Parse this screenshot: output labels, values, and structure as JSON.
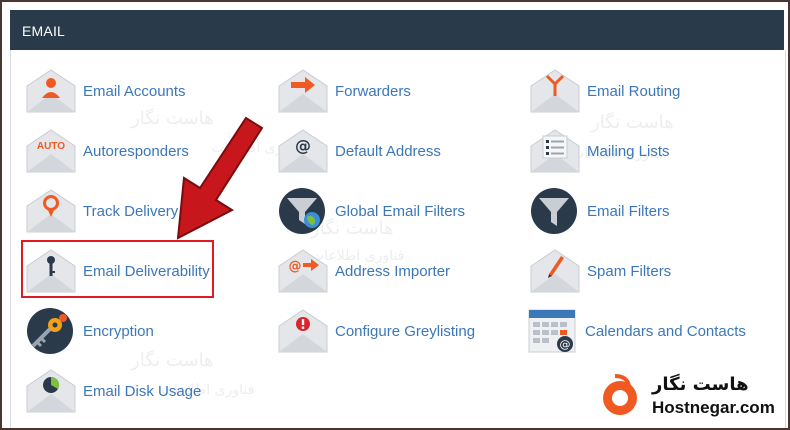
{
  "header": {
    "title": "EMAIL"
  },
  "items": [
    {
      "label": "Email Accounts",
      "icon": "envelope-person-icon"
    },
    {
      "label": "Forwarders",
      "icon": "envelope-arrow-icon"
    },
    {
      "label": "Email Routing",
      "icon": "envelope-routing-icon"
    },
    {
      "label": "Autoresponders",
      "icon": "envelope-auto-icon"
    },
    {
      "label": "Default Address",
      "icon": "envelope-at-icon"
    },
    {
      "label": "Mailing Lists",
      "icon": "envelope-list-icon"
    },
    {
      "label": "Track Delivery",
      "icon": "envelope-pin-icon"
    },
    {
      "label": "Global Email Filters",
      "icon": "globe-filter-icon"
    },
    {
      "label": "Email Filters",
      "icon": "funnel-filter-icon"
    },
    {
      "label": "Email Deliverability",
      "icon": "envelope-key-icon"
    },
    {
      "label": "Address Importer",
      "icon": "envelope-import-icon"
    },
    {
      "label": "Spam Filters",
      "icon": "envelope-pen-icon"
    },
    {
      "label": "Encryption",
      "icon": "key-lock-icon"
    },
    {
      "label": "Configure Greylisting",
      "icon": "envelope-alert-icon"
    },
    {
      "label": "Calendars and Contacts",
      "icon": "calendar-icon"
    },
    {
      "label": "Email Disk Usage",
      "icon": "envelope-pie-icon"
    }
  ],
  "auto_text": "AUTO",
  "watermark": {
    "fa_title": "هاست نگار",
    "fa_sub": "فناوری اطلاعات"
  },
  "logo": {
    "fa": "هاست نگار",
    "en": "Hostnegar.com"
  },
  "colors": {
    "header_bg": "#293a4a",
    "link": "#3c77b8",
    "accent": "#f05a22",
    "highlight": "#e01a22",
    "arrow": "#c8161d"
  }
}
